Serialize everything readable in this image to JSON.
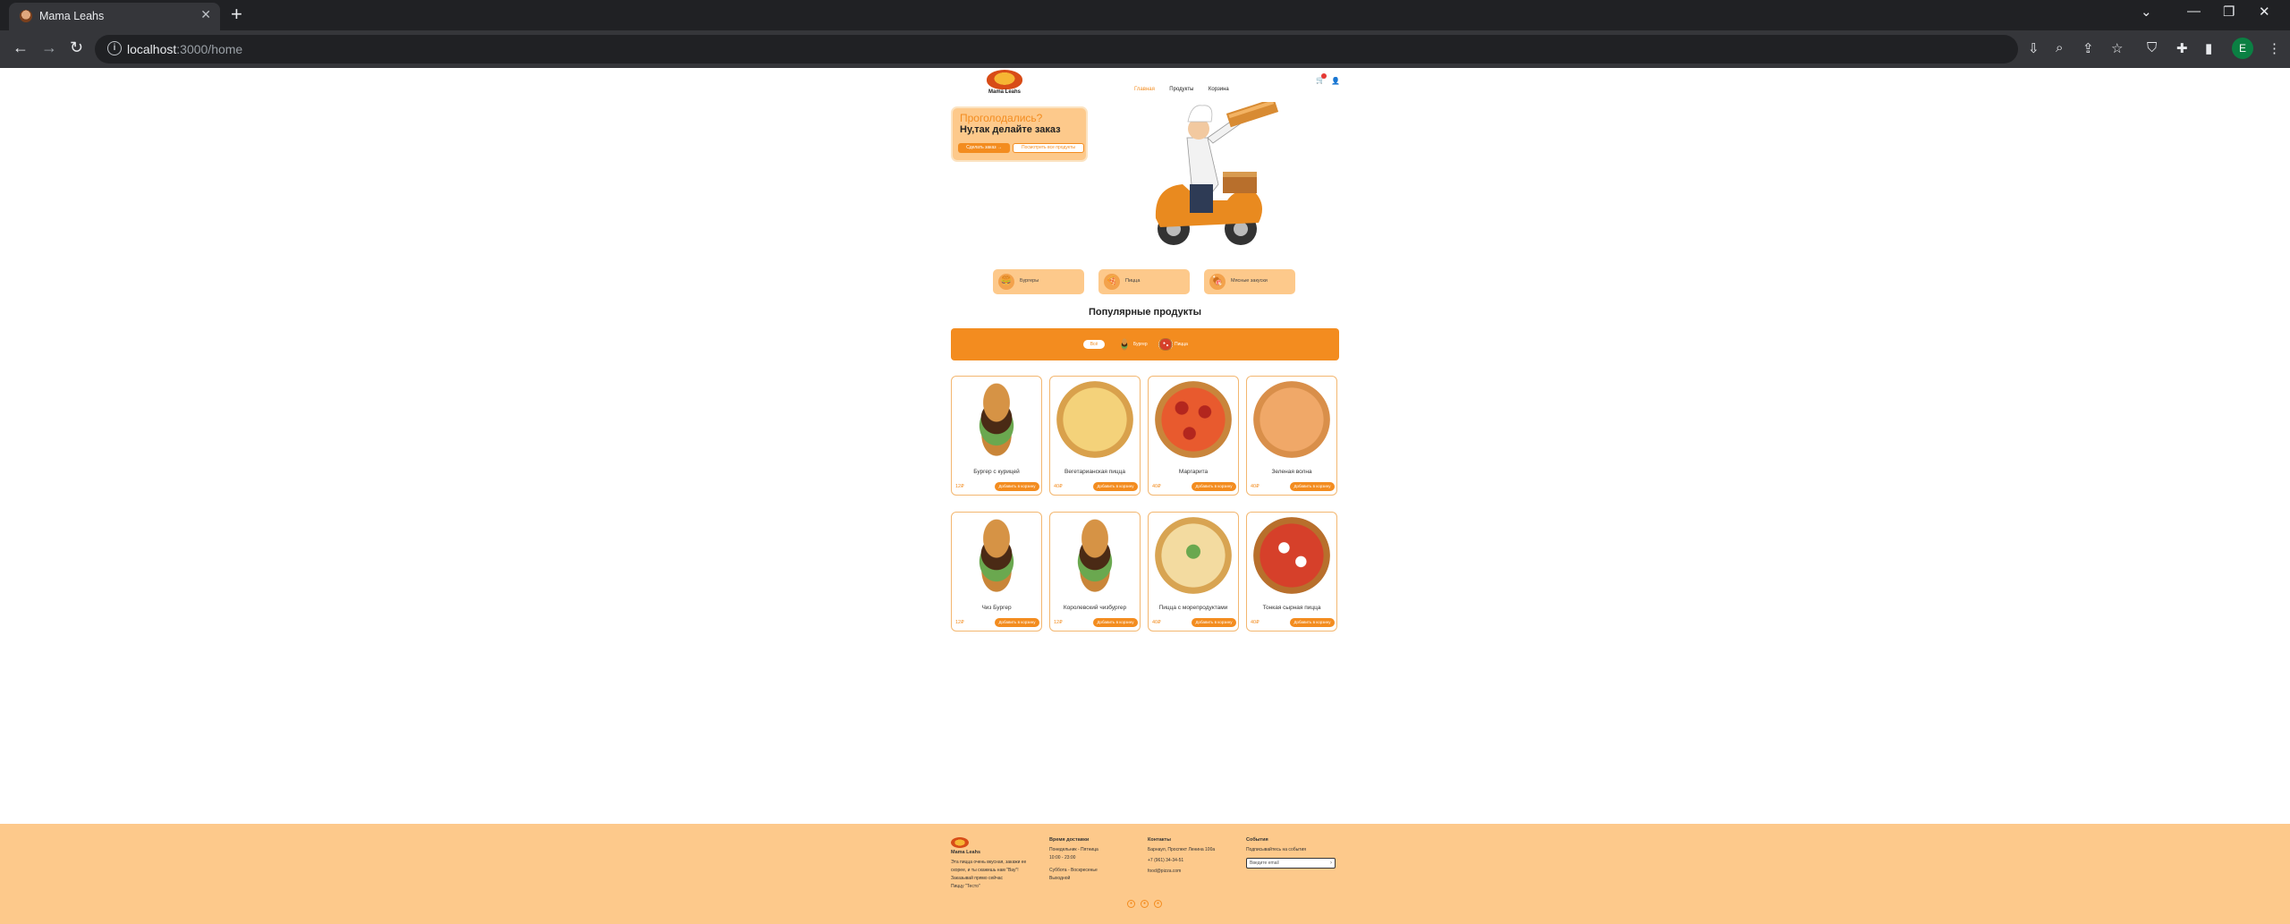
{
  "browser": {
    "tab_title": "Mama Leahs",
    "url_host": "localhost",
    "url_path": ":3000/home",
    "profile_initial": "E"
  },
  "header": {
    "logo_text": "Mama Leahs",
    "nav": [
      "Главная",
      "Продукты",
      "Корзина"
    ]
  },
  "hero": {
    "question": "Проголодались?",
    "title": "Ну,так делайте заказ",
    "order_button": "Сделать заказ →",
    "all_products_button": "Посмотреть все продукты"
  },
  "categories": [
    "Бургеры",
    "Пицца",
    "Мясные закуски"
  ],
  "popular": {
    "title": "Популярные продукты",
    "filter_all": "Всё",
    "filters": [
      "Бургер",
      "Пицца"
    ]
  },
  "products": [
    {
      "name": "Бургер с курицей",
      "price": "12₽",
      "button": "Добавить в корзину"
    },
    {
      "name": "Вегетарианская пицца",
      "price": "40₽",
      "button": "Добавить в корзину"
    },
    {
      "name": "Маргарита",
      "price": "40₽",
      "button": "Добавить в корзину"
    },
    {
      "name": "Зеленая волна",
      "price": "40₽",
      "button": "Добавить в корзину"
    },
    {
      "name": "Чиз Бургер",
      "price": "12₽",
      "button": "Добавить в корзину"
    },
    {
      "name": "Королевский чизбургер",
      "price": "12₽",
      "button": "Добавить в корзину"
    },
    {
      "name": "Пицца с морепродуктами",
      "price": "40₽",
      "button": "Добавить в корзину"
    },
    {
      "name": "Тонкая сырная пицца",
      "price": "40₽",
      "button": "Добавить в корзину"
    }
  ],
  "footer": {
    "logo_text": "Mama Leahs",
    "about": [
      "Эта пицца очень вкусная, закажи ее",
      "скорее, и ты скажешь нам \"Вау\"!",
      "Заказывай прямо сейчас",
      "Пиццу \"Тесто\""
    ],
    "delivery_title": "Время доставки",
    "delivery_lines": [
      "Понедельник - Пятница",
      "10:00 - 23:00",
      "Суббота - Воскресенье",
      "Выходной"
    ],
    "contacts_title": "Контакты",
    "contacts_lines": [
      "Барнаул, Проспект Ленина 100а",
      "+7 (961) 34-34-51",
      "food@pizza.com"
    ],
    "subscribe_title": "События",
    "subscribe_text": "Подписывайтесь на события",
    "subscribe_placeholder": "Введите email"
  },
  "colors": {
    "accent": "#f38c1f",
    "light_orange": "#fdc98b"
  }
}
